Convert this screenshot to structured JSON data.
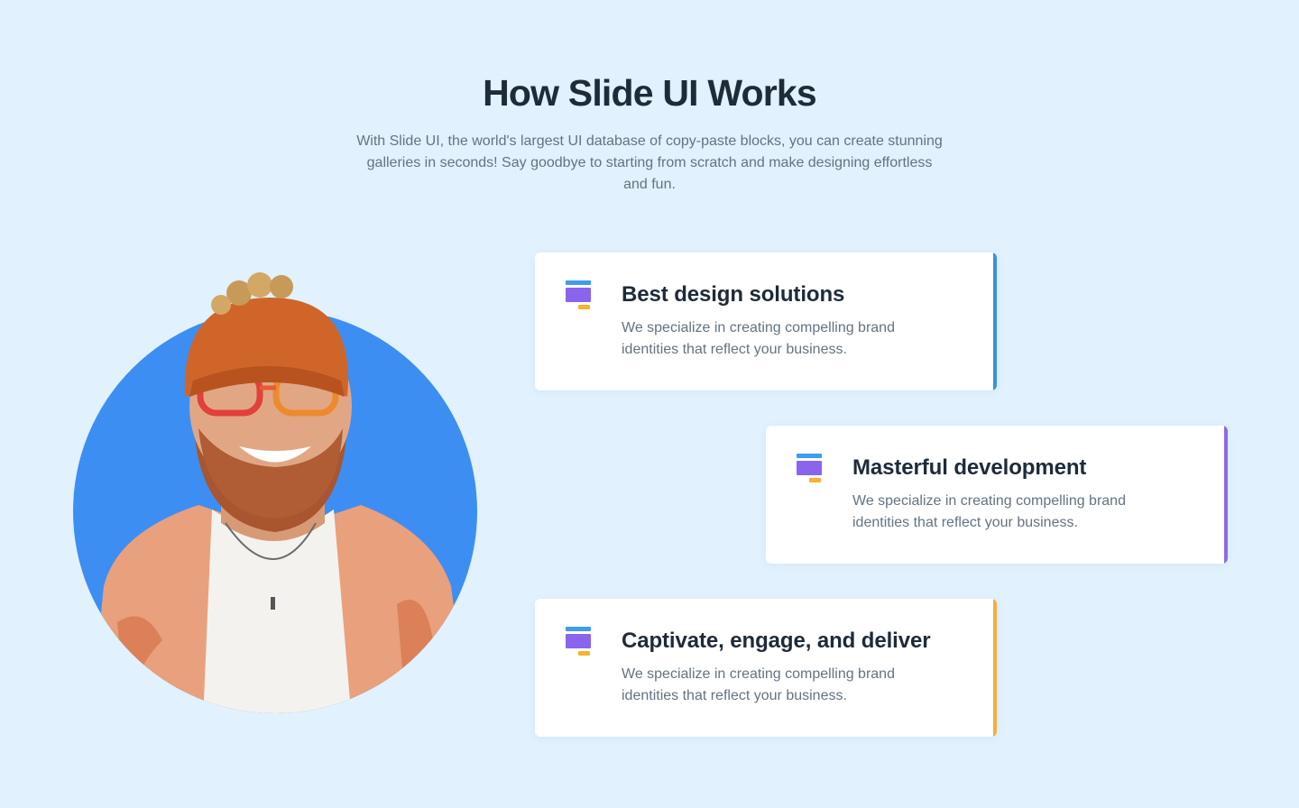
{
  "section": {
    "title": "How Slide UI Works",
    "subtitle": "With Slide UI, the world's largest UI database of copy-paste blocks, you can create stunning galleries in seconds! Say goodbye to starting from scratch and make designing effortless and fun."
  },
  "portrait": {
    "icon": "smiling-man-photo",
    "background_color": "#3d8ef2"
  },
  "features": [
    {
      "title": "Best design solutions",
      "text": "We specialize in creating compelling brand identities that reflect your business.",
      "icon": "layers-icon",
      "accent": "#3f8fd9"
    },
    {
      "title": "Masterful development",
      "text": "We specialize in creating compelling brand identities that reflect your business.",
      "icon": "layers-icon",
      "accent": "#8d6be6"
    },
    {
      "title": "Captivate, engage, and deliver",
      "text": "We specialize in creating compelling brand identities that reflect your business.",
      "icon": "layers-icon",
      "accent": "#f0b03f"
    }
  ]
}
